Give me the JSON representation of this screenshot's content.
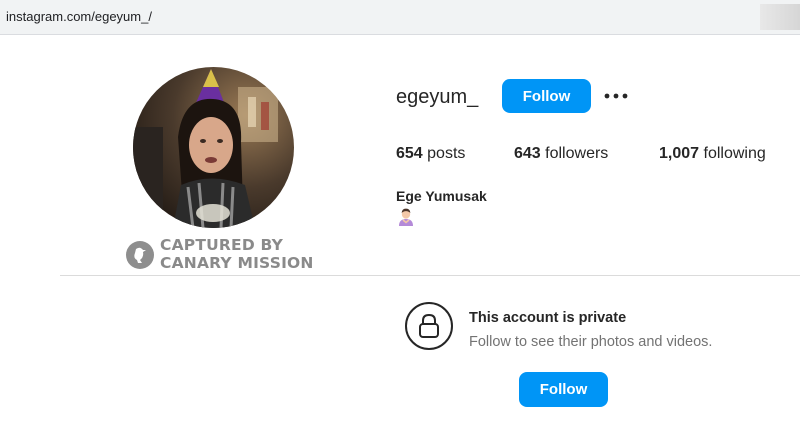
{
  "browser": {
    "url": "instagram.com/egeyum_/"
  },
  "profile": {
    "username": "egeyum_",
    "follow_label": "Follow",
    "more_icon": "more-horizontal-icon",
    "stats": {
      "posts_count": "654",
      "posts_label": "posts",
      "followers_count": "643",
      "followers_label": "followers",
      "following_count": "1,007",
      "following_label": "following"
    },
    "full_name": "Ege Yumusak",
    "bio_emoji": "person-gesturing-emoji",
    "avatar": "profile-photo"
  },
  "watermark": {
    "line1": "CAPTURED BY",
    "line2": "CANARY MISSION"
  },
  "private_notice": {
    "icon": "lock-icon",
    "title": "This account is private",
    "subtitle": "Follow to see their photos and videos.",
    "follow_label": "Follow"
  },
  "colors": {
    "accent": "#0095f6",
    "text": "#262626",
    "muted": "#737373",
    "watermark": "#8a8a8a"
  }
}
